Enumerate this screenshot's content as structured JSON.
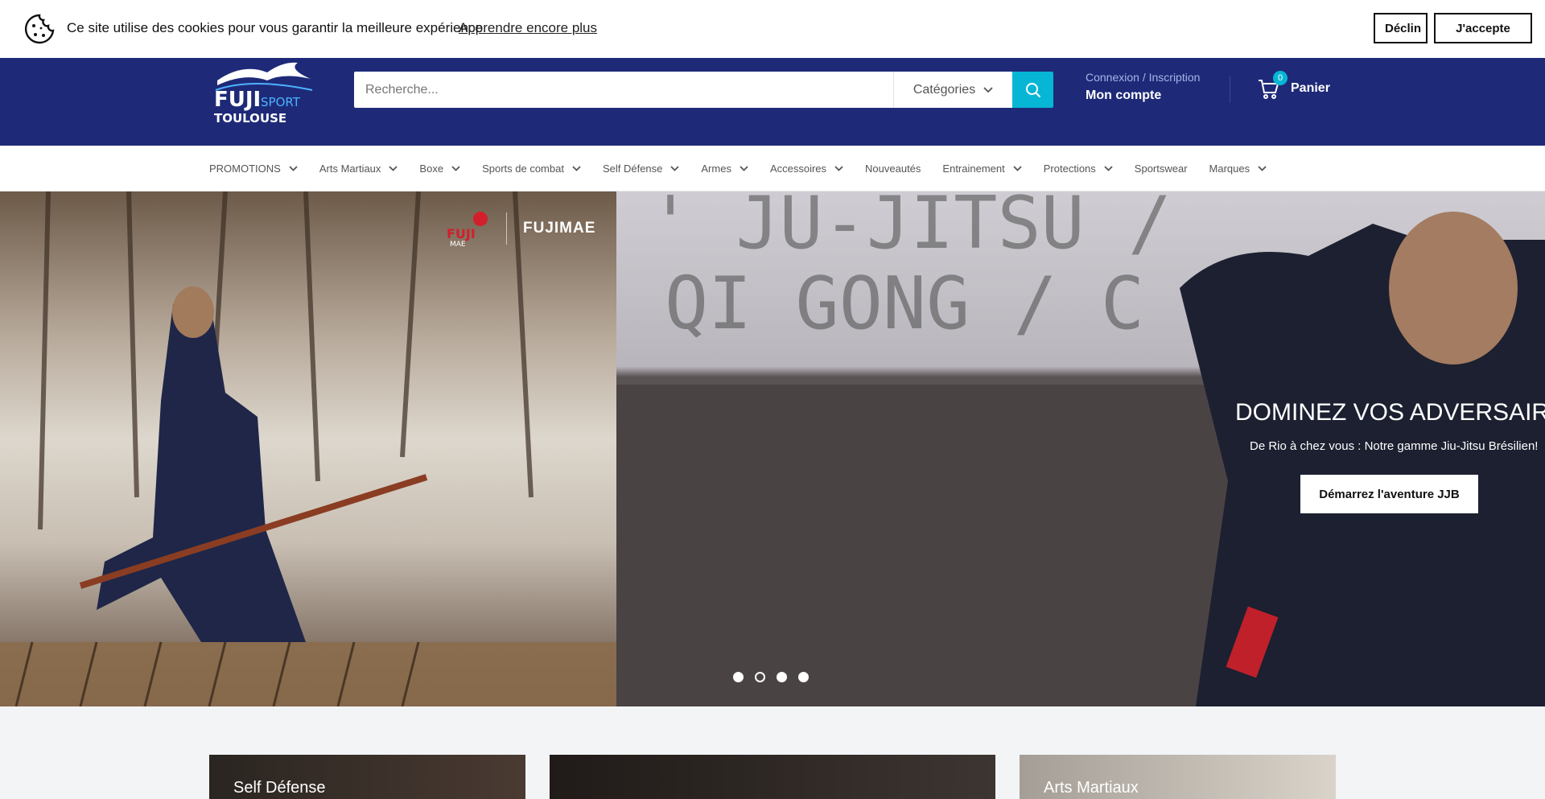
{
  "cookie": {
    "message": "Ce site utilise des cookies pour vous garantir la meilleure expérience.",
    "learn_more": "Apprendre encore plus",
    "decline": "Déclin",
    "accept": "J'accepte"
  },
  "header": {
    "logo_text": "FUJI SPORT TOULOUSE",
    "search_placeholder": "Recherche...",
    "categories_label": "Catégories",
    "account_login": "Connexion / Inscription",
    "account_title": "Mon compte",
    "cart_count": "0",
    "cart_label": "Panier",
    "accent": "#06b6d4",
    "brand": "#1e2a78"
  },
  "nav": {
    "items": [
      {
        "label": "PROMOTIONS",
        "has_dropdown": true
      },
      {
        "label": "Arts Martiaux",
        "has_dropdown": true
      },
      {
        "label": "Boxe",
        "has_dropdown": true
      },
      {
        "label": "Sports de combat",
        "has_dropdown": true
      },
      {
        "label": "Self Défense",
        "has_dropdown": true
      },
      {
        "label": "Armes",
        "has_dropdown": true
      },
      {
        "label": "Accessoires",
        "has_dropdown": true
      },
      {
        "label": "Nouveautés",
        "has_dropdown": false
      },
      {
        "label": "Entrainement",
        "has_dropdown": true
      },
      {
        "label": "Protections",
        "has_dropdown": true
      },
      {
        "label": "Sportswear",
        "has_dropdown": false
      },
      {
        "label": "Marques",
        "has_dropdown": true
      }
    ]
  },
  "hero": {
    "brand_logo": "FUJIMAE",
    "title": "DOMINEZ VOS ADVERSAIRES",
    "subtitle": "De Rio à chez vous : Notre gamme Jiu-Jitsu Brésilien!",
    "cta": "Démarrez l'aventure JJB",
    "slide_count": 4,
    "active_slide": 2
  },
  "collections": [
    {
      "title": "Self Défense"
    },
    {
      "title": ""
    },
    {
      "title": "Arts Martiaux"
    }
  ]
}
